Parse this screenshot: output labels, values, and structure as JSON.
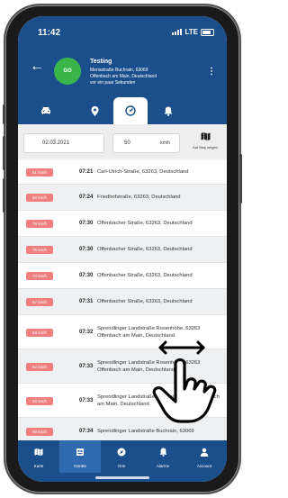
{
  "status_bar": {
    "time": "11:42",
    "network": "LTE"
  },
  "vehicle": {
    "avatar_text": "GO",
    "name": "Testing",
    "address_line1": "Meriastraße Buchrain, 63069",
    "address_line2": "Offenbach am Main, Deutschland",
    "last_seen": "vor ein paar Sekunden"
  },
  "tabs": [
    {
      "icon": "car-icon"
    },
    {
      "icon": "location-pin-icon"
    },
    {
      "icon": "speedometer-icon",
      "active": true
    },
    {
      "icon": "bell-icon"
    }
  ],
  "filters": {
    "date": "02.03.2021",
    "speed": "50",
    "speed_unit": "km/h",
    "map_button_label": "Auf Map zeigen"
  },
  "rows": [
    {
      "speed": "51 km/h",
      "time": "07:21",
      "address": "Carl-Ulrich-Straße, 63263, Deutschland"
    },
    {
      "speed": "50 km/h",
      "time": "07:24",
      "address": "Friedhofstraße, 63263, Deutschland"
    },
    {
      "speed": "79 km/h",
      "time": "07:30",
      "address": "Offenbacher Straße, 63263, Deutschland"
    },
    {
      "speed": "76 km/h",
      "time": "07:30",
      "address": "Offenbacher Straße, 63263, Deutschland"
    },
    {
      "speed": "73 km/h",
      "time": "07:30",
      "address": "Offenbacher Straße, 63263, Deutschland"
    },
    {
      "speed": "67 km/h",
      "time": "07:31",
      "address": "Offenbacher Straße, 63263, Deutschland"
    },
    {
      "speed": "63 km/h",
      "time": "07:32",
      "address": "Sprendlinger Landstraße Rosenhöhe, 63263 Offenbach am Main, Deutschland"
    },
    {
      "speed": "62 km/h",
      "time": "07:33",
      "address": "Sprendlinger Landstraße Rosenhöhe, 63263 Offenbach am Main, Deutschland"
    },
    {
      "speed": "63 km/h",
      "time": "07:33",
      "address": "Sprendlinger Landstraße Buchrain, 63069 Offenbach am Main, Deutschland"
    },
    {
      "speed": "69 km/h",
      "time": "07:34",
      "address": "Sprendlinger Landstraße Buchrain, 63069"
    }
  ],
  "bottom_nav": [
    {
      "label": "Karte",
      "icon": "map-icon"
    },
    {
      "label": "Geräte",
      "icon": "devices-icon",
      "active": true
    },
    {
      "label": "Orte",
      "icon": "compass-icon"
    },
    {
      "label": "Alarme",
      "icon": "bell-icon"
    },
    {
      "label": "Account",
      "icon": "person-icon"
    }
  ],
  "colors": {
    "primary": "#1a4f8c",
    "avatar": "#39b54a",
    "speed_badge": "#f08080"
  }
}
